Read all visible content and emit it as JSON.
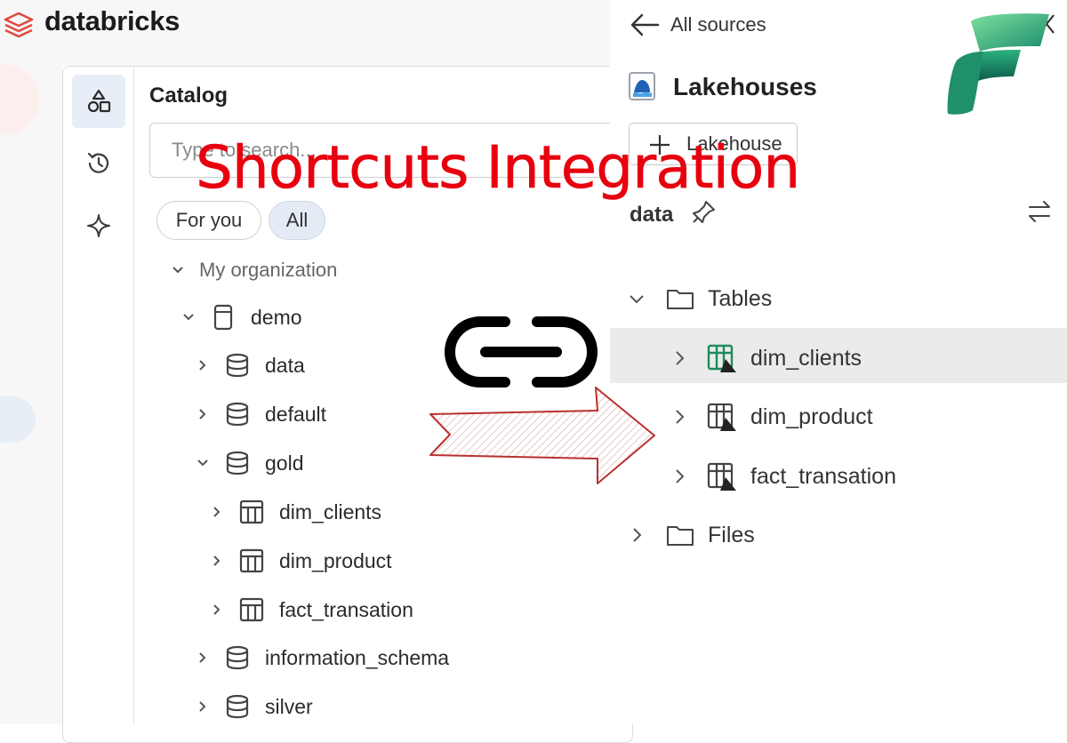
{
  "databricks": {
    "logo_text": "databricks",
    "catalog_title": "Catalog",
    "search_placeholder": "Type to search...",
    "filters": [
      "For you",
      "All"
    ],
    "tree": [
      {
        "label": "My organization"
      },
      {
        "label": "demo"
      },
      {
        "label": "data"
      },
      {
        "label": "default"
      },
      {
        "label": "gold"
      },
      {
        "label": "dim_clients"
      },
      {
        "label": "dim_product"
      },
      {
        "label": "fact_transation"
      },
      {
        "label": "information_schema"
      },
      {
        "label": "silver"
      }
    ]
  },
  "fabric": {
    "back_label": "All sources",
    "section_title": "Lakehouses",
    "add_button": "Lakehouse",
    "lakehouse_name": "data",
    "tree": [
      {
        "label": "Tables"
      },
      {
        "label": "dim_clients"
      },
      {
        "label": "dim_product"
      },
      {
        "label": "fact_transation"
      },
      {
        "label": "Files"
      }
    ]
  },
  "overlay": {
    "headline": "Shortcuts Integration"
  },
  "colors": {
    "headline": "#e8000f",
    "arrow_stroke": "#b9302f",
    "databricks_red": "#e2483b",
    "selection_bg": "#e4ebf4",
    "fabric_green": "#1e8c5a"
  },
  "icons": {
    "databricks_logo": "databricks-logo-icon",
    "fabric_logo": "fabric-logo-icon",
    "link": "link-icon",
    "arrow": "right-arrow-icon"
  }
}
